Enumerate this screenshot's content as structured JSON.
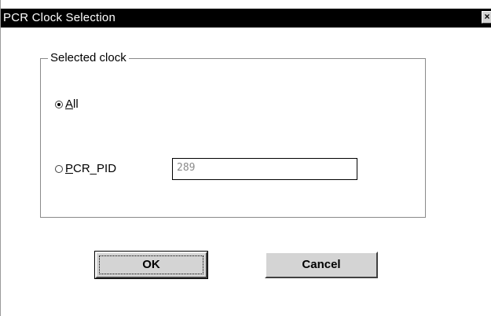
{
  "window": {
    "title": "PCR Clock Selection",
    "close_glyph": "×"
  },
  "group": {
    "legend": "Selected clock"
  },
  "options": {
    "all": {
      "accel": "A",
      "rest": "ll",
      "checked": true
    },
    "pcr_pid": {
      "accel": "P",
      "rest": "CR_PID",
      "checked": false
    }
  },
  "pcr_pid_field": {
    "value": "289"
  },
  "buttons": {
    "ok_label": "OK",
    "cancel_label": "Cancel"
  }
}
